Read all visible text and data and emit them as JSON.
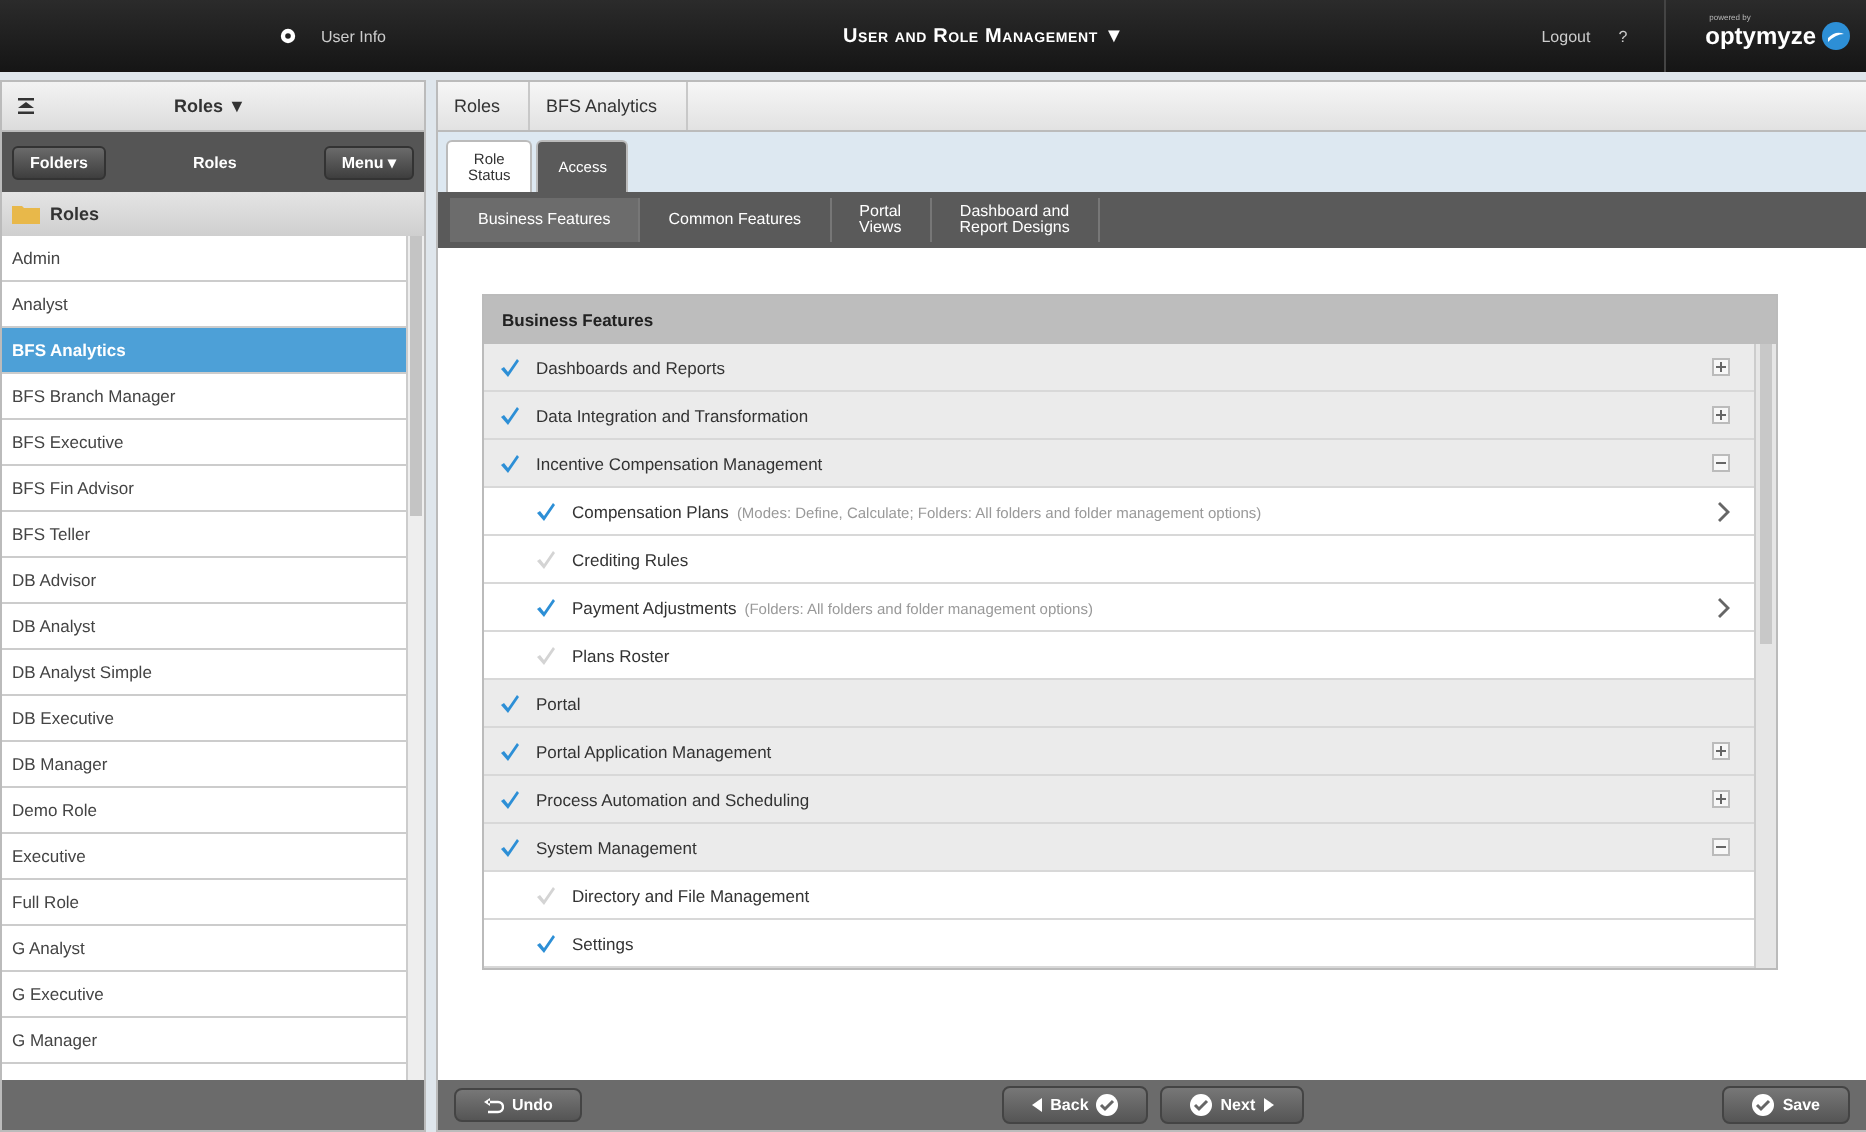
{
  "topbar": {
    "user_info": "User Info",
    "title": "User and Role Management",
    "title_caret": "▼",
    "logout": "Logout",
    "help": "?",
    "powered_by": "powered by",
    "logo": "optymyze"
  },
  "sidebar": {
    "header": "Roles ▼",
    "toolbar": {
      "folders": "Folders",
      "title": "Roles",
      "menu": "Menu ▾"
    },
    "folder": "Roles",
    "items": [
      {
        "label": "Admin",
        "selected": false
      },
      {
        "label": "Analyst",
        "selected": false
      },
      {
        "label": "BFS Analytics",
        "selected": true
      },
      {
        "label": "BFS Branch Manager",
        "selected": false
      },
      {
        "label": "BFS Executive",
        "selected": false
      },
      {
        "label": "BFS Fin Advisor",
        "selected": false
      },
      {
        "label": "BFS Teller",
        "selected": false
      },
      {
        "label": "DB Advisor",
        "selected": false
      },
      {
        "label": "DB Analyst",
        "selected": false
      },
      {
        "label": "DB Analyst Simple",
        "selected": false
      },
      {
        "label": "DB Executive",
        "selected": false
      },
      {
        "label": "DB Manager",
        "selected": false
      },
      {
        "label": "Demo Role",
        "selected": false
      },
      {
        "label": "Executive",
        "selected": false
      },
      {
        "label": "Full Role",
        "selected": false
      },
      {
        "label": "G Analyst",
        "selected": false
      },
      {
        "label": "G Executive",
        "selected": false
      },
      {
        "label": "G Manager",
        "selected": false
      }
    ]
  },
  "breadcrumb": [
    "Roles",
    "BFS Analytics"
  ],
  "tabs": [
    {
      "label": "Role\nStatus",
      "selected": false
    },
    {
      "label": "Access",
      "selected": true
    }
  ],
  "subtabs": [
    {
      "label": "Business Features",
      "selected": true
    },
    {
      "label": "Common Features",
      "selected": false
    },
    {
      "label": "Portal\nViews",
      "selected": false
    },
    {
      "label": "Dashboard and\nReport Designs",
      "selected": false
    }
  ],
  "features": {
    "header": "Business Features",
    "rows": [
      {
        "kind": "group",
        "label": "Dashboards and Reports",
        "checked": true,
        "expanded": false
      },
      {
        "kind": "group",
        "label": "Data Integration and Transformation",
        "checked": true,
        "expanded": false
      },
      {
        "kind": "group",
        "label": "Incentive Compensation Management",
        "checked": true,
        "expanded": true
      },
      {
        "kind": "item",
        "label": "Compensation Plans",
        "note": "(Modes: Define, Calculate; Folders: All folders and folder management options)",
        "checked": true,
        "chevron": true
      },
      {
        "kind": "item",
        "label": "Crediting Rules",
        "checked": false,
        "chevron": false
      },
      {
        "kind": "item",
        "label": "Payment Adjustments",
        "note": "(Folders: All folders and folder management options)",
        "checked": true,
        "chevron": true
      },
      {
        "kind": "item",
        "label": "Plans Roster",
        "checked": false,
        "chevron": false
      },
      {
        "kind": "leaf",
        "label": "Portal",
        "checked": true
      },
      {
        "kind": "group",
        "label": "Portal Application Management",
        "checked": true,
        "expanded": false
      },
      {
        "kind": "group",
        "label": "Process Automation and Scheduling",
        "checked": true,
        "expanded": false
      },
      {
        "kind": "group",
        "label": "System Management",
        "checked": true,
        "expanded": true
      },
      {
        "kind": "item",
        "label": "Directory and File Management",
        "checked": false,
        "chevron": false
      },
      {
        "kind": "item",
        "label": "Settings",
        "checked": true,
        "chevron": false
      }
    ]
  },
  "footer": {
    "undo": "Undo",
    "back": "Back",
    "next": "Next",
    "save": "Save"
  }
}
